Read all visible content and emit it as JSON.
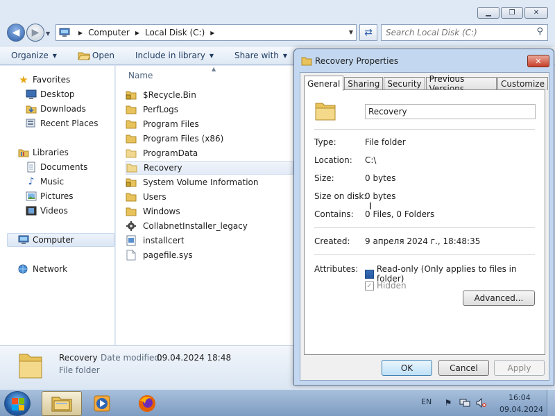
{
  "explorer": {
    "address": {
      "crumbs": [
        "Computer",
        "Local Disk (C:)"
      ]
    },
    "search": {
      "placeholder": "Search Local Disk (C:)"
    },
    "toolbar": {
      "organize": "Organize",
      "open": "Open",
      "include_in_library": "Include in library",
      "share_with": "Share with"
    },
    "nav": {
      "favorites": "Favorites",
      "desktop": "Desktop",
      "downloads": "Downloads",
      "recent_places": "Recent Places",
      "libraries": "Libraries",
      "documents": "Documents",
      "music": "Music",
      "pictures": "Pictures",
      "videos": "Videos",
      "computer": "Computer",
      "network": "Network"
    },
    "filelist": {
      "column_name": "Name",
      "items": [
        {
          "name": "$Recycle.Bin",
          "icon": "locked-folder-icon"
        },
        {
          "name": "PerfLogs",
          "icon": "folder-icon"
        },
        {
          "name": "Program Files",
          "icon": "folder-icon"
        },
        {
          "name": "Program Files (x86)",
          "icon": "folder-icon"
        },
        {
          "name": "ProgramData",
          "icon": "folder-icon"
        },
        {
          "name": "Recovery",
          "icon": "folder-icon"
        },
        {
          "name": "System Volume Information",
          "icon": "locked-folder-icon"
        },
        {
          "name": "Users",
          "icon": "folder-icon"
        },
        {
          "name": "Windows",
          "icon": "folder-icon"
        },
        {
          "name": "CollabnetInstaller_legacy",
          "icon": "installer-icon"
        },
        {
          "name": "installcert",
          "icon": "file-icon"
        },
        {
          "name": "pagefile.sys",
          "icon": "system-file-icon"
        }
      ]
    },
    "details": {
      "name": "Recovery",
      "date_modified_label": "Date modified:",
      "date_modified": "09.04.2024 18:48",
      "type": "File folder"
    }
  },
  "properties": {
    "title": "Recovery Properties",
    "tabs": [
      "General",
      "Sharing",
      "Security",
      "Previous Versions",
      "Customize"
    ],
    "folder_name": "Recovery",
    "type_label": "Type:",
    "type_value": "File folder",
    "location_label": "Location:",
    "location_value": "C:\\",
    "size_label": "Size:",
    "size_value": "0 bytes",
    "size_on_disk_label": "Size on disk:",
    "size_on_disk_value": "0 bytes",
    "contains_label": "Contains:",
    "contains_value": "0 Files, 0 Folders",
    "created_label": "Created:",
    "created_value": "9 апреля 2024 г., 18:48:35",
    "attributes_label": "Attributes:",
    "readonly_label": "Read-only (Only applies to files in folder)",
    "hidden_label": "Hidden",
    "advanced_button": "Advanced...",
    "ok_button": "OK",
    "cancel_button": "Cancel",
    "apply_button": "Apply"
  },
  "taskbar": {
    "language": "EN",
    "time": "16:04",
    "date": "09.04.2024"
  },
  "colors": {
    "accent": "#2c5ea8",
    "folder": "#e8c25a",
    "selection": "#dce7f5"
  }
}
